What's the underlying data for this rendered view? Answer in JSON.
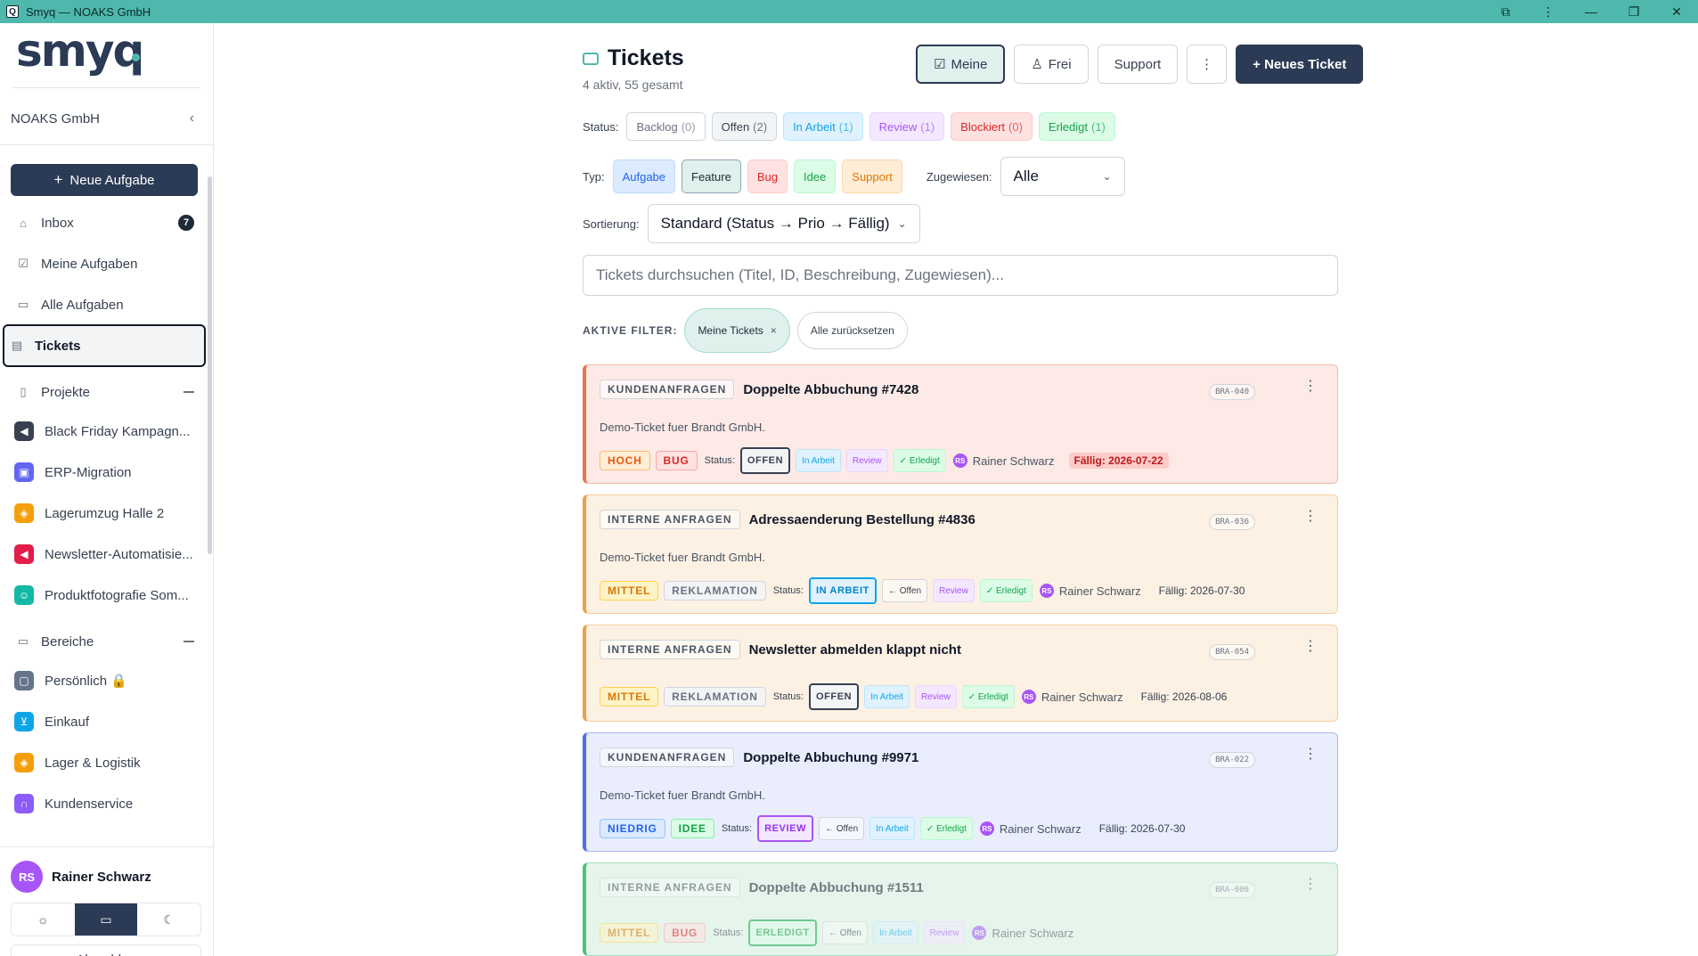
{
  "window": {
    "title": "Smyq — NOAKS GmbH"
  },
  "sidebar": {
    "logo": "smyq",
    "org": "NOAKS GmbH",
    "new_task": "Neue Aufgabe",
    "nav": [
      {
        "label": "Inbox",
        "badge": "7"
      },
      {
        "label": "Meine Aufgaben"
      },
      {
        "label": "Alle Aufgaben"
      },
      {
        "label": "Tickets"
      }
    ],
    "projects_label": "Projekte",
    "projects": [
      {
        "label": "Black Friday Kampagn...",
        "color": "#374151"
      },
      {
        "label": "ERP-Migration",
        "color": "#6366f1"
      },
      {
        "label": "Lagerumzug Halle 2",
        "color": "#f59e0b"
      },
      {
        "label": "Newsletter-Automatisie...",
        "color": "#e11d48"
      },
      {
        "label": "Produktfotografie Som...",
        "color": "#14b8a6"
      }
    ],
    "areas_label": "Bereiche",
    "areas": [
      {
        "label": "Persönlich 🔒",
        "color": "#64748b"
      },
      {
        "label": "Einkauf",
        "color": "#0ea5e9"
      },
      {
        "label": "Lager & Logistik",
        "color": "#f59e0b"
      },
      {
        "label": "Kundenservice",
        "color": "#8b5cf6"
      }
    ],
    "user": {
      "initials": "RS",
      "name": "Rainer Schwarz"
    },
    "logout": "Abmelden"
  },
  "header": {
    "title": "Tickets",
    "subtitle": "4 aktiv, 55 gesamt",
    "btn_mine": "Meine",
    "btn_free": "Frei",
    "btn_support": "Support",
    "btn_new": "+ Neues Ticket"
  },
  "filters": {
    "status_label": "Status:",
    "status": [
      {
        "label": "Backlog",
        "count": "(0)"
      },
      {
        "label": "Offen",
        "count": "(2)"
      },
      {
        "label": "In Arbeit",
        "count": "(1)"
      },
      {
        "label": "Review",
        "count": "(1)"
      },
      {
        "label": "Blockiert",
        "count": "(0)"
      },
      {
        "label": "Erledigt",
        "count": "(1)"
      }
    ],
    "type_label": "Typ:",
    "types": [
      "Aufgabe",
      "Feature",
      "Bug",
      "Idee",
      "Support"
    ],
    "assigned_label": "Zugewiesen:",
    "assigned_value": "Alle",
    "sort_label": "Sortierung:",
    "sort_value": "Standard (Status → Prio → Fällig)",
    "search_placeholder": "Tickets durchsuchen (Titel, ID, Beschreibung, Zugewiesen)...",
    "active_label": "AKTIVE FILTER:",
    "active_pill": "Meine Tickets",
    "reset": "Alle zurücksetzen"
  },
  "status_word": "Status:",
  "tickets": [
    {
      "category": "KUNDENANFRAGEN",
      "title": "Doppelte Abbuchung #7428",
      "id": "BRA-040",
      "desc": "Demo-Ticket fuer Brandt GmbH.",
      "prio": "HOCH",
      "type": "BUG",
      "status": "OFFEN",
      "others": [
        "In Arbeit",
        "Review",
        "✓ Erledigt"
      ],
      "assignee": "Rainer Schwarz",
      "due": "Fällig: 2026-07-22"
    },
    {
      "category": "INTERNE ANFRAGEN",
      "title": "Adressaenderung Bestellung #4836",
      "id": "BRA-036",
      "desc": "Demo-Ticket fuer Brandt GmbH.",
      "prio": "MITTEL",
      "type": "REKLAMATION",
      "status": "IN ARBEIT",
      "others": [
        "← Offen",
        "Review",
        "✓ Erledigt"
      ],
      "assignee": "Rainer Schwarz",
      "due": "Fällig: 2026-07-30"
    },
    {
      "category": "INTERNE ANFRAGEN",
      "title": "Newsletter abmelden klappt nicht",
      "id": "BRA-054",
      "prio": "MITTEL",
      "type": "REKLAMATION",
      "status": "OFFEN",
      "others": [
        "In Arbeit",
        "Review",
        "✓ Erledigt"
      ],
      "assignee": "Rainer Schwarz",
      "due": "Fällig: 2026-08-06"
    },
    {
      "category": "KUNDENANFRAGEN",
      "title": "Doppelte Abbuchung #9971",
      "id": "BRA-022",
      "desc": "Demo-Ticket fuer Brandt GmbH.",
      "prio": "NIEDRIG",
      "type": "IDEE",
      "status": "REVIEW",
      "others": [
        "← Offen",
        "In Arbeit",
        "✓ Erledigt"
      ],
      "assignee": "Rainer Schwarz",
      "due": "Fällig: 2026-07-30"
    },
    {
      "category": "INTERNE ANFRAGEN",
      "title": "Doppelte Abbuchung #1511",
      "id": "BRA-006",
      "prio": "MITTEL",
      "type": "BUG",
      "status": "ERLEDIGT",
      "others": [
        "← Offen",
        "In Arbeit",
        "Review"
      ],
      "assignee": "Rainer Schwarz"
    }
  ]
}
